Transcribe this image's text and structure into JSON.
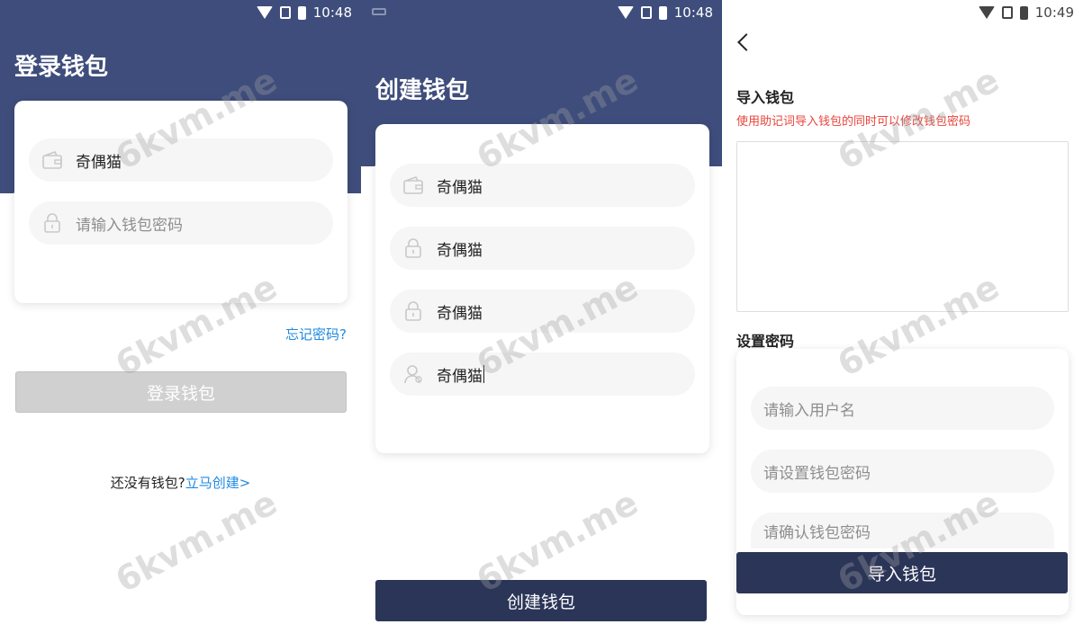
{
  "watermark": "6kvm.me",
  "colors": {
    "navy": "#3e4d7b",
    "dark_button": "#2b3558",
    "disabled_button": "#d0d0d0",
    "link": "#1f8ae0",
    "hint": "#e8453c"
  },
  "login": {
    "status_time": "10:48",
    "title": "登录钱包",
    "wallet_value": "奇偶猫",
    "password_placeholder": "请输入钱包密码",
    "forgot": "忘记密码?",
    "login_button": "登录钱包",
    "no_wallet_text": "还没有钱包?",
    "create_link": "立马创建>"
  },
  "create": {
    "status_time": "10:48",
    "title": "创建钱包",
    "fields": [
      "奇偶猫",
      "奇偶猫",
      "奇偶猫",
      "奇偶猫"
    ],
    "create_button": "创建钱包"
  },
  "import": {
    "status_time": "10:49",
    "title": "导入钱包",
    "hint": "使用助记词导入钱包的同时可以修改钱包密码",
    "mnemonic_value": "",
    "set_password_label": "设置密码",
    "username_placeholder": "请输入用户名",
    "password_placeholder": "请设置钱包密码",
    "confirm_placeholder": "请确认钱包密码",
    "import_button": "导入钱包"
  }
}
